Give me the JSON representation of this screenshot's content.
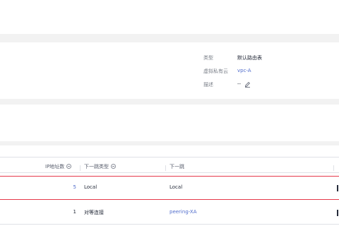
{
  "details": {
    "type_label": "类型",
    "type_value": "默认路由表",
    "vpc_label": "虚拟私有云",
    "vpc_value": "vpc-A",
    "desc_label": "描述",
    "desc_value": "--",
    "edit_icon": "pencil-icon"
  },
  "table": {
    "columns": [
      "IP地址数",
      "下一跳类型",
      "下一跳"
    ],
    "rows": [
      {
        "ip_count": "5",
        "next_hop_type": "Local",
        "next_hop": "Local",
        "highlighted": true
      },
      {
        "ip_count": "1",
        "next_hop_type": "对等连接",
        "next_hop": "peering-XA",
        "highlighted": false
      }
    ]
  },
  "colors": {
    "link": "#526ecc",
    "highlight_border": "#e5394b",
    "page_bg": "#f2f2f2"
  }
}
